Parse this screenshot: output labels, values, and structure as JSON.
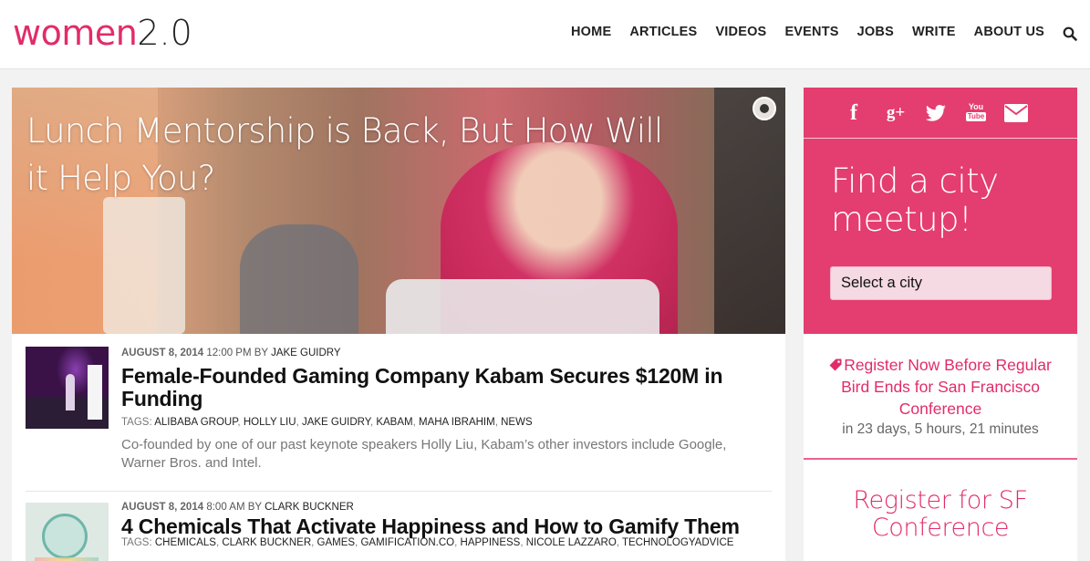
{
  "header": {
    "logo_word": "women",
    "logo_num": "2.0",
    "nav": [
      "HOME",
      "ARTICLES",
      "VIDEOS",
      "EVENTS",
      "JOBS",
      "WRITE",
      "ABOUT US"
    ],
    "search_icon": "search-icon"
  },
  "hero": {
    "title": "Lunch Mentorship is Back, But How Will it Help You?"
  },
  "articles": [
    {
      "date": "AUGUST 8, 2014",
      "time": "12:00 PM BY",
      "author": "JAKE GUIDRY",
      "title": "Female-Founded Gaming Company Kabam Secures $120M in Funding",
      "tags_label": "TAGS:",
      "tags": [
        "ALIBABA GROUP",
        "HOLLY LIU",
        "JAKE GUIDRY",
        "KABAM",
        "MAHA IBRAHIM",
        "NEWS"
      ],
      "excerpt": "Co-founded by one of our past keynote speakers Holly Liu, Kabam’s other investors include Google, Warner Bros. and Intel."
    },
    {
      "date": "AUGUST 8, 2014",
      "time": "8:00 AM BY",
      "author": "CLARK BUCKNER",
      "title": "4 Chemicals That Activate Happiness and How to Gamify Them",
      "tags_label": "TAGS:",
      "tags": [
        "CHEMICALS",
        "CLARK BUCKNER",
        "GAMES",
        "GAMIFICATION.CO",
        "HAPPINESS",
        "NICOLE LAZZARO",
        "TECHNOLOGYADVICE"
      ]
    }
  ],
  "sidebar": {
    "social_icons": [
      "facebook-icon",
      "google-plus-icon",
      "twitter-icon",
      "youtube-icon",
      "mail-icon"
    ],
    "youtube_top": "You",
    "youtube_bottom": "Tube",
    "city_heading": "Find a city meetup!",
    "city_select": "Select a city",
    "register_link": "Register Now Before Regular Bird Ends for San Francisco Conference",
    "countdown": "in 23 days, 5 hours, 21 minutes",
    "register_sf": "Register for SF Conference"
  },
  "colors": {
    "brand_pink": "#e12c6a",
    "sidebar_pink": "#e43d6f"
  }
}
